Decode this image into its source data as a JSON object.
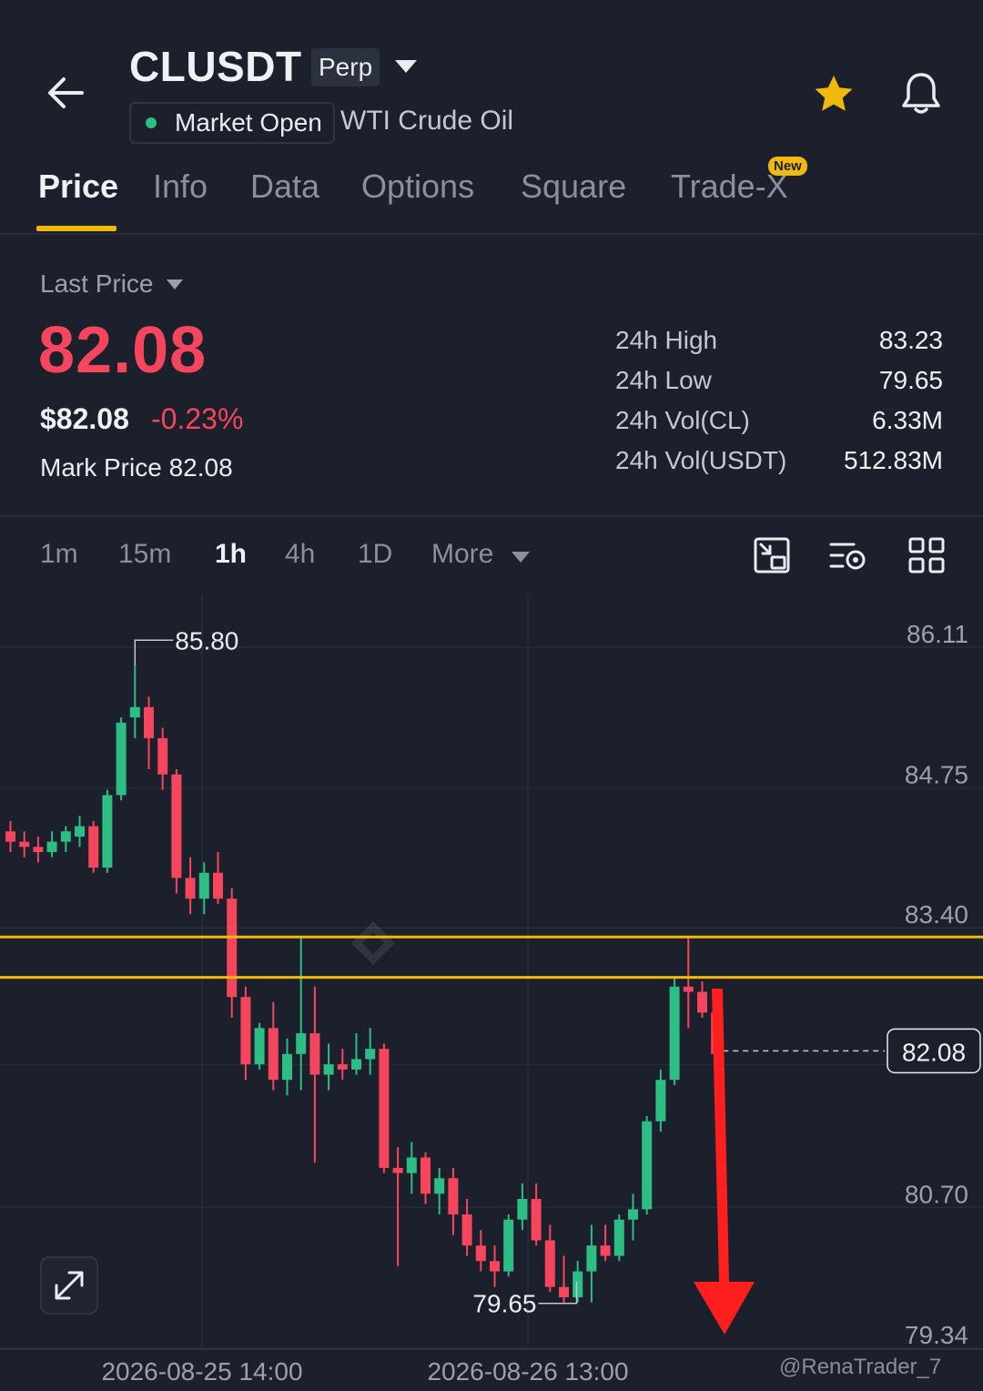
{
  "header": {
    "symbol": "CLUSDT",
    "contract_badge": "Perp",
    "market_status": "Market Open",
    "subtitle": "WTI Crude Oil",
    "icons": [
      "back-arrow-icon",
      "chevron-down-icon",
      "star-icon",
      "bell-icon"
    ],
    "star_color": "#f0b90b"
  },
  "tabs": [
    {
      "label": "Price",
      "active": true
    },
    {
      "label": "Info"
    },
    {
      "label": "Data"
    },
    {
      "label": "Options"
    },
    {
      "label": "Square"
    },
    {
      "label": "Trade-X",
      "badge": "New"
    }
  ],
  "price": {
    "last_price_label": "Last Price",
    "last_price": "82.08",
    "usd_value": "$82.08",
    "change_pct": "-0.23%",
    "mark_label": "Mark Price",
    "mark_value": "82.08"
  },
  "stats": [
    {
      "label": "24h High",
      "value": "83.23"
    },
    {
      "label": "24h Low",
      "value": "79.65"
    },
    {
      "label": "24h Vol(CL)",
      "value": "6.33M"
    },
    {
      "label": "24h Vol(USDT)",
      "value": "512.83M"
    }
  ],
  "intervals": [
    {
      "label": "1m"
    },
    {
      "label": "15m"
    },
    {
      "label": "1h",
      "active": true
    },
    {
      "label": "4h"
    },
    {
      "label": "1D"
    },
    {
      "label": "More"
    }
  ],
  "colors": {
    "up": "#2ebd85",
    "down": "#f6465d",
    "accent": "#f0b90b",
    "arrow": "#ff1f1f"
  },
  "watermark": "@RenaTrader_7",
  "chart_data": {
    "type": "candlestick",
    "y_ticks": [
      "86.11",
      "84.75",
      "83.40",
      "82.08",
      "80.70",
      "79.34"
    ],
    "ylim": [
      79.34,
      86.11
    ],
    "x_labels": [
      "2026-08-25 14:00",
      "2026-08-26 13:00"
    ],
    "annotations": {
      "high": "85.80",
      "low": "79.65"
    },
    "current_price": "82.08",
    "horizontal_lines": [
      83.18,
      82.79
    ],
    "candles": [
      {
        "o": 84.2,
        "h": 84.3,
        "l": 84.0,
        "c": 84.1
      },
      {
        "o": 84.1,
        "h": 84.2,
        "l": 83.95,
        "c": 84.05
      },
      {
        "o": 84.05,
        "h": 84.15,
        "l": 83.9,
        "c": 84.0
      },
      {
        "o": 84.0,
        "h": 84.2,
        "l": 83.95,
        "c": 84.1
      },
      {
        "o": 84.1,
        "h": 84.25,
        "l": 84.0,
        "c": 84.2
      },
      {
        "o": 84.15,
        "h": 84.35,
        "l": 84.05,
        "c": 84.25
      },
      {
        "o": 84.25,
        "h": 84.3,
        "l": 83.8,
        "c": 83.85
      },
      {
        "o": 83.85,
        "h": 84.6,
        "l": 83.8,
        "c": 84.55
      },
      {
        "o": 84.55,
        "h": 85.3,
        "l": 84.5,
        "c": 85.25
      },
      {
        "o": 85.3,
        "h": 85.8,
        "l": 85.1,
        "c": 85.4
      },
      {
        "o": 85.4,
        "h": 85.5,
        "l": 84.8,
        "c": 85.1
      },
      {
        "o": 85.1,
        "h": 85.2,
        "l": 84.6,
        "c": 84.75
      },
      {
        "o": 84.75,
        "h": 84.8,
        "l": 83.6,
        "c": 83.75
      },
      {
        "o": 83.75,
        "h": 83.95,
        "l": 83.4,
        "c": 83.55
      },
      {
        "o": 83.55,
        "h": 83.9,
        "l": 83.4,
        "c": 83.8
      },
      {
        "o": 83.8,
        "h": 84.0,
        "l": 83.5,
        "c": 83.55
      },
      {
        "o": 83.55,
        "h": 83.65,
        "l": 82.4,
        "c": 82.6
      },
      {
        "o": 82.6,
        "h": 82.7,
        "l": 81.8,
        "c": 81.95
      },
      {
        "o": 81.95,
        "h": 82.35,
        "l": 81.9,
        "c": 82.3
      },
      {
        "o": 82.3,
        "h": 82.55,
        "l": 81.7,
        "c": 81.8
      },
      {
        "o": 81.8,
        "h": 82.2,
        "l": 81.65,
        "c": 82.05
      },
      {
        "o": 82.05,
        "h": 83.18,
        "l": 81.7,
        "c": 82.25
      },
      {
        "o": 82.25,
        "h": 82.7,
        "l": 81.0,
        "c": 81.85
      },
      {
        "o": 81.85,
        "h": 82.15,
        "l": 81.7,
        "c": 81.95
      },
      {
        "o": 81.95,
        "h": 82.1,
        "l": 81.8,
        "c": 81.9
      },
      {
        "o": 81.9,
        "h": 82.25,
        "l": 81.85,
        "c": 82.0
      },
      {
        "o": 82.0,
        "h": 82.3,
        "l": 81.85,
        "c": 82.1
      },
      {
        "o": 82.1,
        "h": 82.15,
        "l": 80.9,
        "c": 80.95
      },
      {
        "o": 80.95,
        "h": 81.15,
        "l": 80.0,
        "c": 80.9
      },
      {
        "o": 80.9,
        "h": 81.2,
        "l": 80.7,
        "c": 81.05
      },
      {
        "o": 81.05,
        "h": 81.1,
        "l": 80.6,
        "c": 80.7
      },
      {
        "o": 80.7,
        "h": 80.95,
        "l": 80.5,
        "c": 80.85
      },
      {
        "o": 80.85,
        "h": 80.95,
        "l": 80.3,
        "c": 80.5
      },
      {
        "o": 80.5,
        "h": 80.65,
        "l": 80.1,
        "c": 80.2
      },
      {
        "o": 80.2,
        "h": 80.35,
        "l": 79.95,
        "c": 80.05
      },
      {
        "o": 80.05,
        "h": 80.2,
        "l": 79.8,
        "c": 79.95
      },
      {
        "o": 79.95,
        "h": 80.5,
        "l": 79.9,
        "c": 80.45
      },
      {
        "o": 80.45,
        "h": 80.8,
        "l": 80.35,
        "c": 80.65
      },
      {
        "o": 80.65,
        "h": 80.8,
        "l": 80.2,
        "c": 80.25
      },
      {
        "o": 80.25,
        "h": 80.4,
        "l": 79.75,
        "c": 79.8
      },
      {
        "o": 79.8,
        "h": 80.1,
        "l": 79.65,
        "c": 79.7
      },
      {
        "o": 79.7,
        "h": 80.05,
        "l": 79.65,
        "c": 79.95
      },
      {
        "o": 79.95,
        "h": 80.4,
        "l": 79.65,
        "c": 80.2
      },
      {
        "o": 80.2,
        "h": 80.4,
        "l": 80.05,
        "c": 80.1
      },
      {
        "o": 80.1,
        "h": 80.5,
        "l": 80.05,
        "c": 80.45
      },
      {
        "o": 80.45,
        "h": 80.7,
        "l": 80.25,
        "c": 80.55
      },
      {
        "o": 80.55,
        "h": 81.45,
        "l": 80.5,
        "c": 81.4
      },
      {
        "o": 81.4,
        "h": 81.9,
        "l": 81.3,
        "c": 81.8
      },
      {
        "o": 81.8,
        "h": 82.8,
        "l": 81.75,
        "c": 82.7
      },
      {
        "o": 82.7,
        "h": 83.18,
        "l": 82.3,
        "c": 82.65
      },
      {
        "o": 82.65,
        "h": 82.75,
        "l": 82.4,
        "c": 82.45
      },
      {
        "o": 82.45,
        "h": 82.5,
        "l": 82.0,
        "c": 82.05
      }
    ]
  }
}
